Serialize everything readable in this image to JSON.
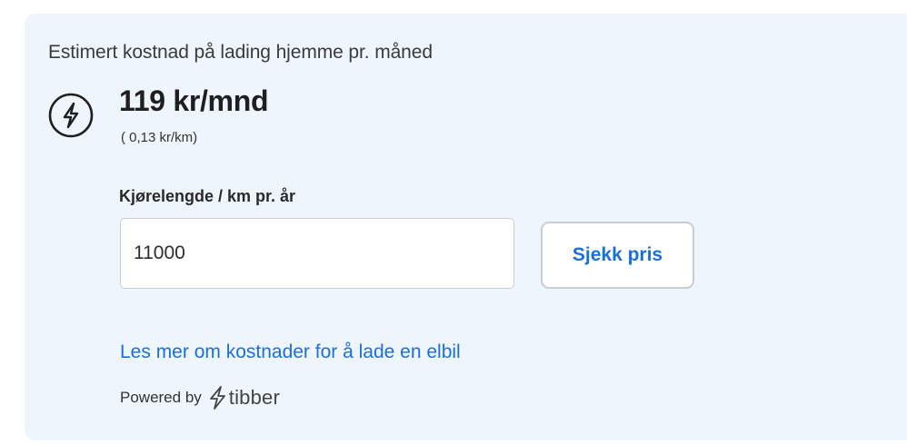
{
  "card": {
    "heading": "Estimert kostnad på lading hjemme pr. måned",
    "icon": "lightning-bolt-circle-icon",
    "price": "119 kr/mnd",
    "price_per_km": "( 0,13 kr/km)"
  },
  "form": {
    "km_label": "Kjørelengde / km pr. år",
    "km_value": "11000",
    "submit_label": "Sjekk pris"
  },
  "footer": {
    "link_text": "Les mer om kostnader for å lade en elbil",
    "powered_by": "Powered by",
    "brand_icon": "lightning-bolt-icon",
    "brand_name": "tibber"
  },
  "colors": {
    "card_background": "#eff5fc",
    "accent_blue": "#1a6fe0",
    "text_dark": "#1f1f1f"
  }
}
